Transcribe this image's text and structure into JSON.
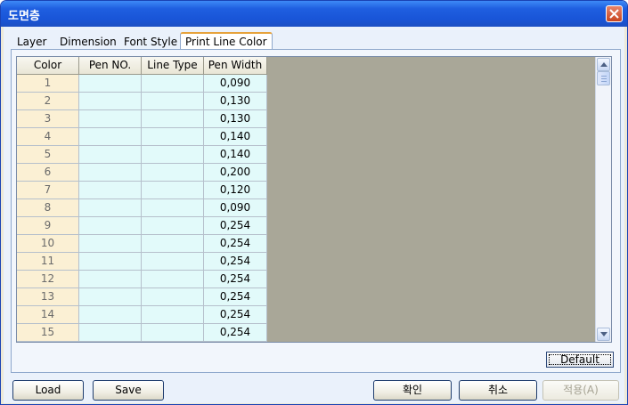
{
  "window": {
    "title": "도면층",
    "accent": "#1955d8"
  },
  "tabs": [
    "Layer",
    "Dimension",
    "Font Style",
    "Print Line Color"
  ],
  "active_tab": "Print Line Color",
  "table": {
    "headers": [
      "Color",
      "Pen NO.",
      "Line Type",
      "Pen Width"
    ],
    "rows": [
      {
        "color": "1",
        "pen": "",
        "line_type": "",
        "width": "0,090"
      },
      {
        "color": "2",
        "pen": "",
        "line_type": "",
        "width": "0,130"
      },
      {
        "color": "3",
        "pen": "",
        "line_type": "",
        "width": "0,130"
      },
      {
        "color": "4",
        "pen": "",
        "line_type": "",
        "width": "0,140"
      },
      {
        "color": "5",
        "pen": "",
        "line_type": "",
        "width": "0,140"
      },
      {
        "color": "6",
        "pen": "",
        "line_type": "",
        "width": "0,200"
      },
      {
        "color": "7",
        "pen": "",
        "line_type": "",
        "width": "0,120"
      },
      {
        "color": "8",
        "pen": "",
        "line_type": "",
        "width": "0,090"
      },
      {
        "color": "9",
        "pen": "",
        "line_type": "",
        "width": "0,254"
      },
      {
        "color": "10",
        "pen": "",
        "line_type": "",
        "width": "0,254"
      },
      {
        "color": "11",
        "pen": "",
        "line_type": "",
        "width": "0,254"
      },
      {
        "color": "12",
        "pen": "",
        "line_type": "",
        "width": "0,254"
      },
      {
        "color": "13",
        "pen": "",
        "line_type": "",
        "width": "0,254"
      },
      {
        "color": "14",
        "pen": "",
        "line_type": "",
        "width": "0,254"
      },
      {
        "color": "15",
        "pen": "",
        "line_type": "",
        "width": "0,254"
      }
    ]
  },
  "buttons": {
    "default": "Default",
    "load": "Load",
    "save": "Save",
    "ok": "확인",
    "cancel": "취소",
    "apply": "적용(A)"
  }
}
